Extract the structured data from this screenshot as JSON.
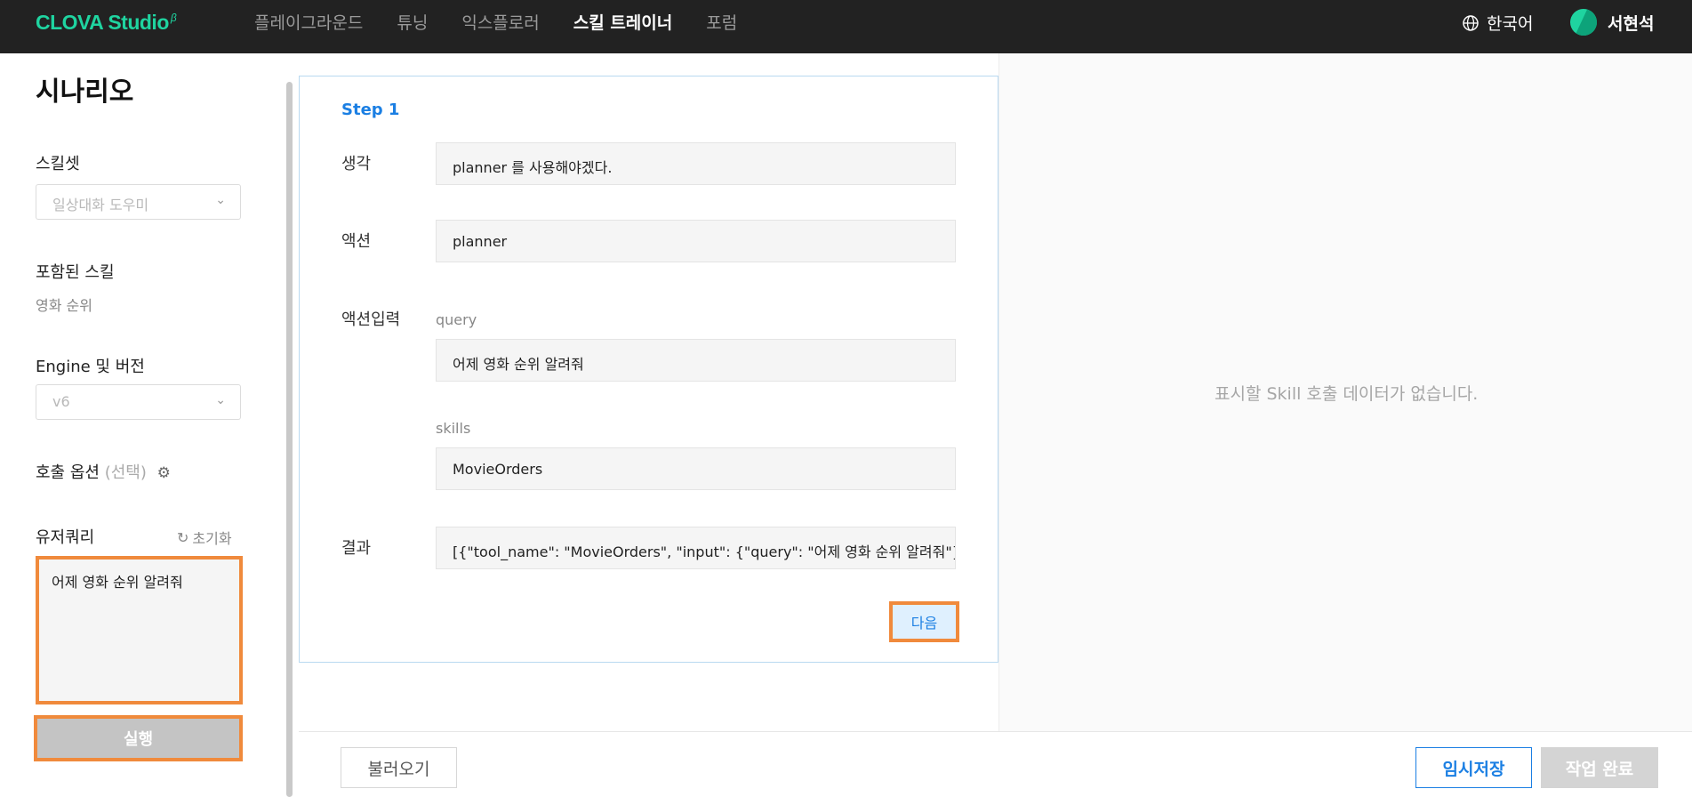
{
  "header": {
    "logo": "CLOVA Studio",
    "logo_sup": "β",
    "nav": [
      "플레이그라운드",
      "튜닝",
      "익스플로러",
      "스킬 트레이너",
      "포럼"
    ],
    "active_nav": "스킬 트레이너",
    "language": "한국어",
    "user_name": "서현석"
  },
  "sidebar": {
    "title": "시나리오",
    "skillset_label": "스킬셋",
    "skillset_value": "일상대화 도우미",
    "included_skills_label": "포함된 스킬",
    "included_skill": "영화 순위",
    "engine_label": "Engine 및 버전",
    "engine_value": "v6",
    "call_option_label": "호출 옵션",
    "call_option_hint": "(선택)",
    "user_query_label": "유저쿼리",
    "reset_label": "초기화",
    "user_query_value": "어제 영화 순위 알려줘",
    "run_label": "실행"
  },
  "step": {
    "title": "Step 1",
    "thought_label": "생각",
    "thought_value": "planner 를 사용해야겠다.",
    "action_label": "액션",
    "action_value": "planner",
    "action_input_label": "액션입력",
    "query_label": "query",
    "query_value": "어제 영화 순위 알려줘",
    "skills_label": "skills",
    "skills_value": "MovieOrders",
    "result_label": "결과",
    "result_value": "[{\"tool_name\": \"MovieOrders\", \"input\": {\"query\": \"어제 영화 순위 알려줘\"}}]",
    "next_label": "다음"
  },
  "right_panel": {
    "empty_message": "표시할 Skill 호출 데이터가 없습니다."
  },
  "footer": {
    "load_label": "불러오기",
    "save_label": "임시저장",
    "done_label": "작업 완료"
  },
  "colors": {
    "topbar": "#222222",
    "brand": "#1fd4a0",
    "accent": "#1b7fe3",
    "highlight": "#f08a3c"
  }
}
